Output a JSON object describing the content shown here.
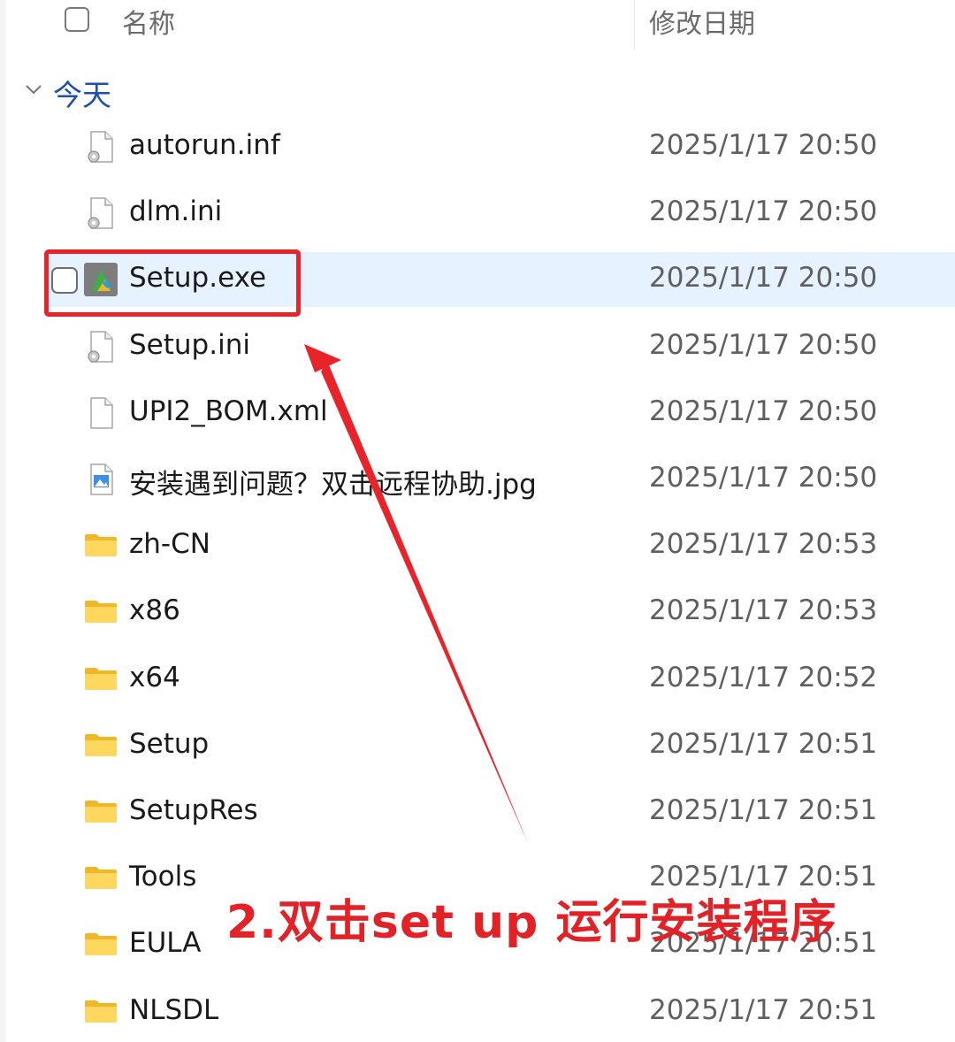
{
  "header": {
    "name_label": "名称",
    "date_label": "修改日期"
  },
  "group": {
    "label": "今天"
  },
  "rows": [
    {
      "name": "autorun.inf",
      "date": "2025/1/17 20:50",
      "icon": "config-file-icon"
    },
    {
      "name": "dlm.ini",
      "date": "2025/1/17 20:50",
      "icon": "config-file-icon"
    },
    {
      "name": "Setup.exe",
      "date": "2025/1/17 20:50",
      "icon": "autodesk-app-icon",
      "selected": true
    },
    {
      "name": "Setup.ini",
      "date": "2025/1/17 20:50",
      "icon": "config-file-icon"
    },
    {
      "name": "UPI2_BOM.xml",
      "date": "2025/1/17 20:50",
      "icon": "blank-file-icon"
    },
    {
      "name": "安装遇到问题？双击远程协助.jpg",
      "date": "2025/1/17 20:50",
      "icon": "image-file-icon"
    },
    {
      "name": "zh-CN",
      "date": "2025/1/17 20:53",
      "icon": "folder-icon"
    },
    {
      "name": "x86",
      "date": "2025/1/17 20:53",
      "icon": "folder-icon"
    },
    {
      "name": "x64",
      "date": "2025/1/17 20:52",
      "icon": "folder-icon"
    },
    {
      "name": "Setup",
      "date": "2025/1/17 20:51",
      "icon": "folder-icon"
    },
    {
      "name": "SetupRes",
      "date": "2025/1/17 20:51",
      "icon": "folder-icon"
    },
    {
      "name": "Tools",
      "date": "2025/1/17 20:51",
      "icon": "folder-icon"
    },
    {
      "name": "EULA",
      "date": "2025/1/17 20:51",
      "icon": "folder-icon"
    },
    {
      "name": "NLSDL",
      "date": "2025/1/17 20:51",
      "icon": "folder-icon"
    }
  ],
  "annotation": {
    "caption": "2.双击set up 运行安装程序",
    "color": "#e32228"
  }
}
